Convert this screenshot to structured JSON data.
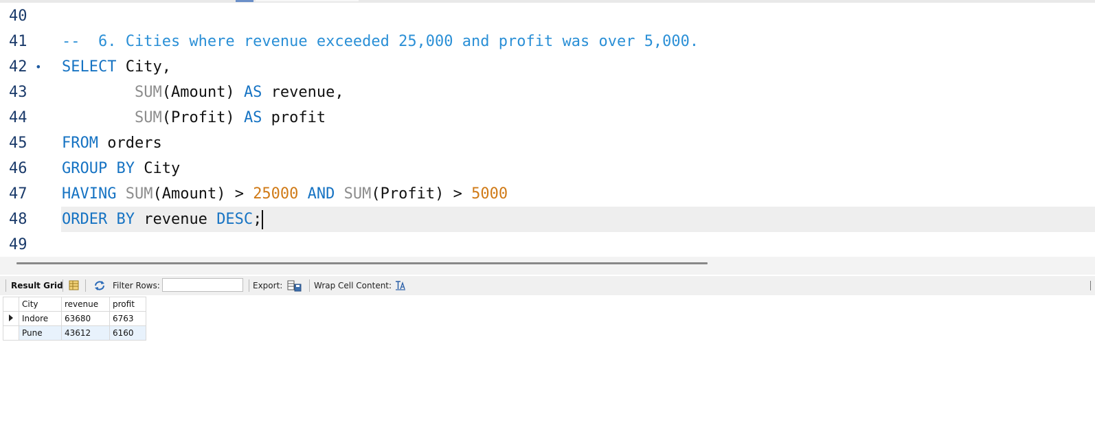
{
  "editor": {
    "lines": [
      {
        "num": "40",
        "marker": "",
        "tokens": []
      },
      {
        "num": "41",
        "marker": "",
        "tokens": [
          {
            "t": "--  6. Cities where revenue exceeded 25,000 and profit was over 5,000.",
            "c": "cmt"
          }
        ]
      },
      {
        "num": "42",
        "marker": "•",
        "tokens": [
          {
            "t": "SELECT",
            "c": "kw"
          },
          {
            "t": " City,",
            "c": "id"
          }
        ]
      },
      {
        "num": "43",
        "marker": "",
        "tokens": [
          {
            "t": "        ",
            "c": "id"
          },
          {
            "t": "SUM",
            "c": "fn"
          },
          {
            "t": "(Amount) ",
            "c": "id"
          },
          {
            "t": "AS",
            "c": "kw"
          },
          {
            "t": " revenue,",
            "c": "id"
          }
        ]
      },
      {
        "num": "44",
        "marker": "",
        "tokens": [
          {
            "t": "        ",
            "c": "id"
          },
          {
            "t": "SUM",
            "c": "fn"
          },
          {
            "t": "(Profit) ",
            "c": "id"
          },
          {
            "t": "AS",
            "c": "kw"
          },
          {
            "t": " profit",
            "c": "id"
          }
        ]
      },
      {
        "num": "45",
        "marker": "",
        "tokens": [
          {
            "t": "FROM",
            "c": "kw"
          },
          {
            "t": " orders",
            "c": "id"
          }
        ]
      },
      {
        "num": "46",
        "marker": "",
        "tokens": [
          {
            "t": "GROUP BY",
            "c": "kw"
          },
          {
            "t": " City",
            "c": "id"
          }
        ]
      },
      {
        "num": "47",
        "marker": "",
        "tokens": [
          {
            "t": "HAVING",
            "c": "kw"
          },
          {
            "t": " ",
            "c": "id"
          },
          {
            "t": "SUM",
            "c": "fn"
          },
          {
            "t": "(Amount) > ",
            "c": "id"
          },
          {
            "t": "25000",
            "c": "num"
          },
          {
            "t": " ",
            "c": "id"
          },
          {
            "t": "AND",
            "c": "kw"
          },
          {
            "t": " ",
            "c": "id"
          },
          {
            "t": "SUM",
            "c": "fn"
          },
          {
            "t": "(Profit) > ",
            "c": "id"
          },
          {
            "t": "5000",
            "c": "num"
          }
        ]
      },
      {
        "num": "48",
        "marker": "",
        "current": true,
        "tokens": [
          {
            "t": "ORDER BY",
            "c": "kw"
          },
          {
            "t": " revenue ",
            "c": "id"
          },
          {
            "t": "DESC",
            "c": "kw"
          },
          {
            "t": ";",
            "c": "id"
          }
        ]
      },
      {
        "num": "49",
        "marker": "",
        "tokens": []
      }
    ]
  },
  "toolbar": {
    "result_grid_label": "Result Grid",
    "filter_rows_label": "Filter Rows:",
    "filter_rows_value": "",
    "export_label": "Export:",
    "wrap_label": "Wrap Cell Content:"
  },
  "grid": {
    "columns": [
      "City",
      "revenue",
      "profit"
    ],
    "rows": [
      [
        "Indore",
        "63680",
        "6763"
      ],
      [
        "Pune",
        "43612",
        "6160"
      ]
    ]
  },
  "colors": {
    "keyword": "#1673c3",
    "function": "#8c8c8c",
    "number": "#d07a16",
    "comment": "#2a8fd6",
    "alt_row": "#e8f2fc"
  }
}
